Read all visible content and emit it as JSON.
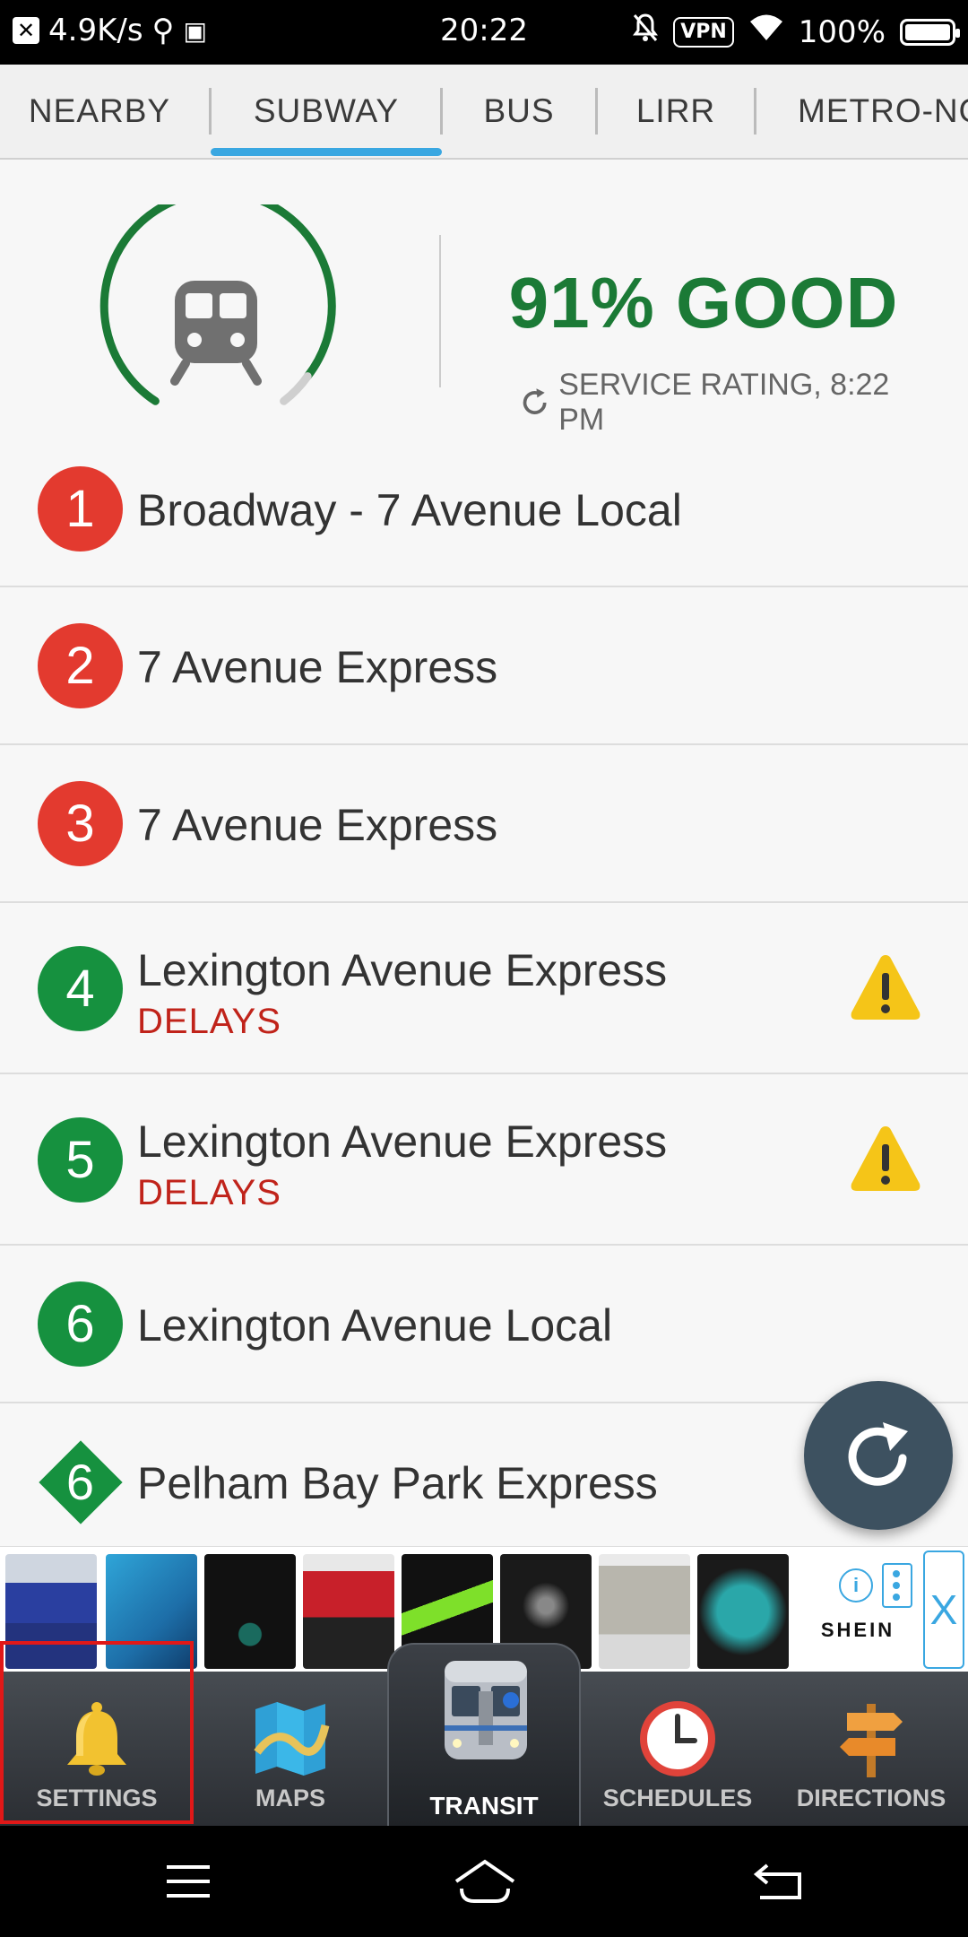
{
  "status_bar": {
    "net_speed": "4.9K/s",
    "time": "20:22",
    "vpn_label": "VPN",
    "battery": "100%"
  },
  "tabs": [
    {
      "label": "NEARBY",
      "selected": false
    },
    {
      "label": "SUBWAY",
      "selected": true
    },
    {
      "label": "BUS",
      "selected": false
    },
    {
      "label": "LIRR",
      "selected": false
    },
    {
      "label": "METRO-NO",
      "selected": false
    }
  ],
  "service": {
    "rating": "91% GOOD",
    "rating_fraction": 0.91,
    "subtitle": "SERVICE RATING, 8:22 PM"
  },
  "routes": [
    {
      "line": "1",
      "name": "Broadway - 7 Avenue Local",
      "status": "",
      "color": "#e33a2f",
      "shape": "circle",
      "alert": false
    },
    {
      "line": "2",
      "name": "7 Avenue Express",
      "status": "",
      "color": "#e33a2f",
      "shape": "circle",
      "alert": false
    },
    {
      "line": "3",
      "name": "7 Avenue Express",
      "status": "",
      "color": "#e33a2f",
      "shape": "circle",
      "alert": false
    },
    {
      "line": "4",
      "name": "Lexington Avenue Express",
      "status": "DELAYS",
      "color": "#16913f",
      "shape": "circle",
      "alert": true
    },
    {
      "line": "5",
      "name": "Lexington Avenue Express",
      "status": "DELAYS",
      "color": "#16913f",
      "shape": "circle",
      "alert": true
    },
    {
      "line": "6",
      "name": "Lexington Avenue Local",
      "status": "",
      "color": "#16913f",
      "shape": "circle",
      "alert": false
    },
    {
      "line": "6",
      "name": "Pelham Bay Park Express",
      "status": "",
      "color": "#16913f",
      "shape": "diamond",
      "alert": false
    }
  ],
  "ad": {
    "brand": "SHEIN",
    "info_icon": "i",
    "close_label": "X"
  },
  "bottom_nav": [
    {
      "label": "SETTINGS",
      "icon": "bell-icon"
    },
    {
      "label": "MAPS",
      "icon": "map-icon"
    },
    {
      "label": "TRANSIT",
      "icon": "subway-train-icon"
    },
    {
      "label": "SCHEDULES",
      "icon": "clock-icon"
    },
    {
      "label": "DIRECTIONS",
      "icon": "signpost-icon"
    }
  ],
  "colors": {
    "accent": "#3aa7e1",
    "good": "#1b7a36",
    "delay": "#c0231a",
    "red_line": "#e33a2f",
    "green_line": "#16913f"
  }
}
